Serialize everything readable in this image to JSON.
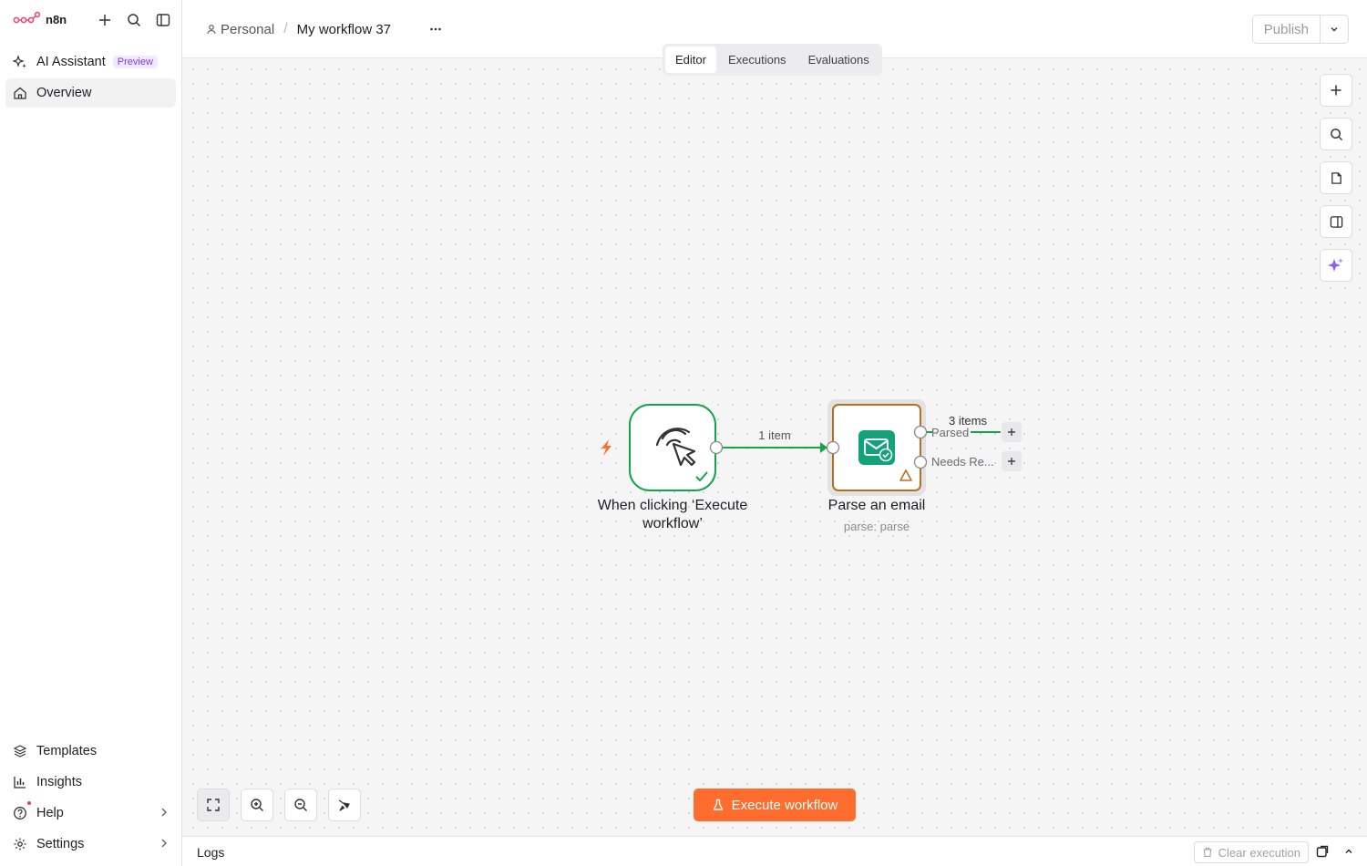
{
  "app": {
    "brand": "n8n"
  },
  "sidebar": {
    "top_items": [
      {
        "label": "AI Assistant",
        "badge": "Preview"
      },
      {
        "label": "Overview"
      }
    ],
    "bottom_items": [
      {
        "label": "Templates"
      },
      {
        "label": "Insights"
      },
      {
        "label": "Help"
      },
      {
        "label": "Settings"
      }
    ]
  },
  "header": {
    "breadcrumb_project": "Personal",
    "workflow_title": "My workflow 37",
    "publish_label": "Publish",
    "tabs": [
      {
        "label": "Editor"
      },
      {
        "label": "Executions"
      },
      {
        "label": "Evaluations"
      }
    ]
  },
  "canvas": {
    "nodes": [
      {
        "title": "When clicking ‘Execute workflow’"
      },
      {
        "title": "Parse an email",
        "subtitle": "parse: parse"
      }
    ],
    "edge_label": "1 item",
    "output_label": "3 items",
    "ports": [
      "Parsed",
      "Needs Re..."
    ],
    "execute_label": "Execute workflow"
  },
  "logs": {
    "title": "Logs",
    "clear_label": "Clear execution"
  },
  "colors": {
    "accent": "#ff6d2e",
    "success": "#16a34a",
    "warning": "#b7701e",
    "email_node": "#12a37a"
  }
}
